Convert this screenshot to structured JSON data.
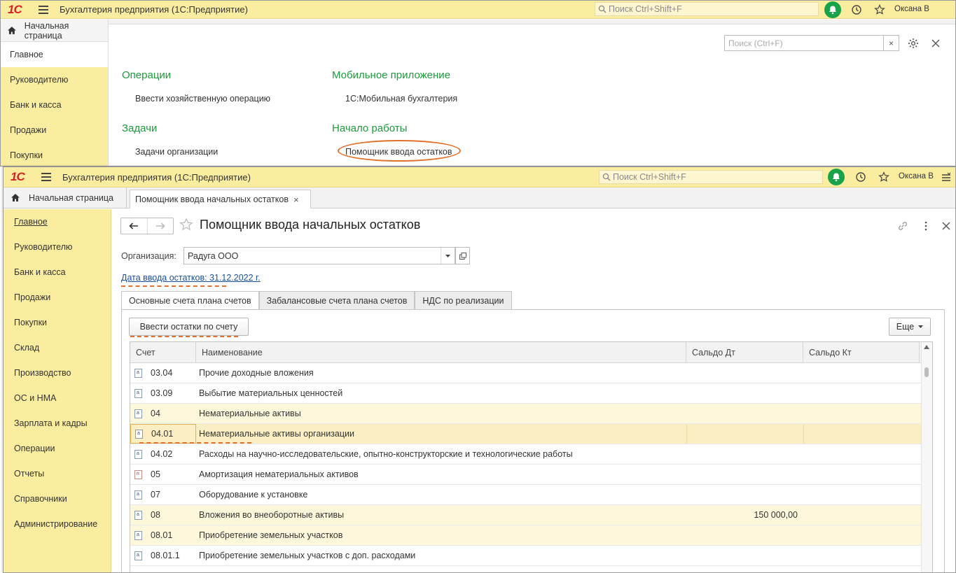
{
  "background_window": {
    "app_title": "Бухгалтерия предприятия  (1С:Предприятие)",
    "search_placeholder": "Поиск Ctrl+Shift+F",
    "user": "Оксана В",
    "home_tab": "Начальная страница",
    "sidebar": [
      "Главное",
      "Руководителю",
      "Банк и касса",
      "Продажи",
      "Покупки"
    ],
    "content_search_placeholder": "Поиск (Ctrl+F)",
    "sections": {
      "operations_title": "Операции",
      "operations_link": "Ввести хозяйственную операцию",
      "tasks_title": "Задачи",
      "tasks_link": "Задачи организации",
      "mobile_title": "Мобильное приложение",
      "mobile_link": "1С:Мобильная бухгалтерия",
      "start_title": "Начало работы",
      "start_link": "Помощник ввода остатков"
    }
  },
  "foreground_window": {
    "app_title": "Бухгалтерия предприятия  (1С:Предприятие)",
    "search_placeholder": "Поиск Ctrl+Shift+F",
    "user": "Оксана В",
    "home_tab": "Начальная страница",
    "open_tab": "Помощник ввода начальных остатков",
    "sidebar": [
      "Главное",
      "Руководителю",
      "Банк и касса",
      "Продажи",
      "Покупки",
      "Склад",
      "Производство",
      "ОС и НМА",
      "Зарплата и кадры",
      "Операции",
      "Отчеты",
      "Справочники",
      "Администрирование"
    ],
    "form": {
      "title": "Помощник ввода начальных остатков",
      "org_label": "Организация:",
      "org_value": "Радуга ООО",
      "date_link": "Дата ввода остатков: 31.12.2022 г.",
      "tabs": [
        "Основные счета плана счетов",
        "Забалансовые счета плана счетов",
        "НДС по реализации"
      ],
      "enter_button": "Ввести остатки по счету",
      "more_button": "Еще",
      "columns": [
        "Счет",
        "Наименование",
        "Сальдо Дт",
        "Сальдо Кт"
      ],
      "rows": [
        {
          "account": "03.04",
          "name": "Прочие доходные вложения",
          "dt": "",
          "kt": "",
          "icon": "a"
        },
        {
          "account": "03.09",
          "name": "Выбытие материальных ценностей",
          "dt": "",
          "kt": "",
          "icon": "a"
        },
        {
          "account": "04",
          "name": "Нематериальные активы",
          "dt": "",
          "kt": "",
          "icon": "a"
        },
        {
          "account": "04.01",
          "name": "Нематериальные активы организации",
          "dt": "",
          "kt": "",
          "icon": "a"
        },
        {
          "account": "04.02",
          "name": "Расходы на научно-исследовательские, опытно-конструкторские и технологические работы",
          "dt": "",
          "kt": "",
          "icon": "a"
        },
        {
          "account": "05",
          "name": "Амортизация нематериальных активов",
          "dt": "",
          "kt": "",
          "icon": "p"
        },
        {
          "account": "07",
          "name": "Оборудование к установке",
          "dt": "",
          "kt": "",
          "icon": "a"
        },
        {
          "account": "08",
          "name": "Вложения во внеоборотные активы",
          "dt": "150 000,00",
          "kt": "",
          "icon": "a"
        },
        {
          "account": "08.01",
          "name": "Приобретение земельных участков",
          "dt": "",
          "kt": "",
          "icon": "a"
        },
        {
          "account": "08.01.1",
          "name": "Приобретение земельных участков с доп. расходами",
          "dt": "",
          "kt": "",
          "icon": "a"
        }
      ]
    }
  },
  "colors": {
    "brand_red": "#d81f26",
    "panel_yellow": "#fbeda0",
    "section_green": "#1e9a3c",
    "annotation_orange": "#e0702a",
    "link_blue": "#1a4f9c",
    "notify_green": "#18a34a"
  }
}
